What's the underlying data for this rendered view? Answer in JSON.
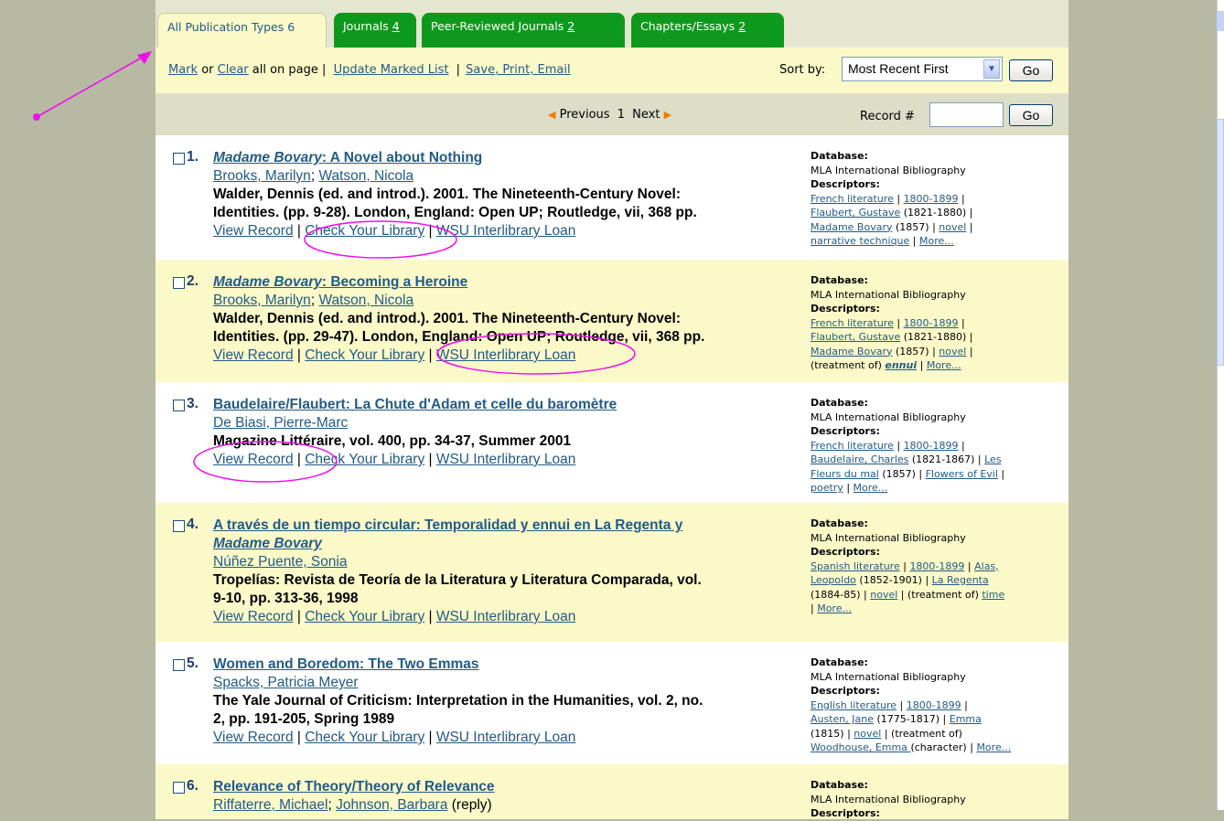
{
  "tabs": [
    {
      "label": "All Publication Types",
      "count": "6"
    },
    {
      "label": "Journals",
      "count": "4"
    },
    {
      "label": "Peer-Reviewed Journals",
      "count": "2"
    },
    {
      "label": "Chapters/Essays",
      "count": "2"
    }
  ],
  "toolbar": {
    "mark": "Mark",
    "or": " or ",
    "clear": "Clear",
    "all_on_page": " all on page ",
    "sep": "|",
    "update": "Update Marked List",
    "save": "Save, Print, Email",
    "sort_label": "Sort by:",
    "sort_value": "Most Recent First",
    "go": "Go"
  },
  "pager": {
    "previous": "Previous",
    "page": "1",
    "next": "Next",
    "record_label": "Record #",
    "go": "Go"
  },
  "colors": {
    "tab_green": "#0d9a1c",
    "link": "#225b87",
    "highlight_bg": "#fbf9c8",
    "annotation": "#ee11ee"
  },
  "results": [
    {
      "num": "1.",
      "title_italic": "Madame Bovary",
      "title_rest": ": A Novel about Nothing",
      "authors": [
        "Brooks, Marilyn",
        "Watson, Nicola"
      ],
      "source_lines": [
        "Walder, Dennis (ed. and introd.). 2001. The Nineteenth-Century Novel:",
        "Identities. (pp. 9-28). London, England: Open UP; Routledge, vii, 368 pp."
      ],
      "links": [
        "View Record",
        "Check Your Library",
        "WSU Interlibrary Loan"
      ],
      "database": "MLA International Bibliography",
      "descriptor_lines": [
        [
          {
            "t": "French literature",
            "l": true
          },
          {
            "t": " | ",
            "l": false
          },
          {
            "t": "1800-1899",
            "l": true
          },
          {
            "t": " |",
            "l": false
          }
        ],
        [
          {
            "t": "Flaubert, Gustave",
            "l": true
          },
          {
            "t": " (1821-1880) |",
            "l": false
          }
        ],
        [
          {
            "t": "Madame Bovary",
            "l": true
          },
          {
            "t": " (1857) | ",
            "l": false
          },
          {
            "t": "novel",
            "l": true
          },
          {
            "t": " |",
            "l": false
          }
        ],
        [
          {
            "t": "narrative technique",
            "l": true
          },
          {
            "t": " | ",
            "l": false
          },
          {
            "t": "More...",
            "l": true
          }
        ]
      ]
    },
    {
      "num": "2.",
      "title_italic": "Madame Bovary",
      "title_rest": ": Becoming a Heroine",
      "authors": [
        "Brooks, Marilyn",
        "Watson, Nicola"
      ],
      "source_lines": [
        "Walder, Dennis (ed. and introd.). 2001. The Nineteenth-Century Novel:",
        "Identities. (pp. 29-47). London, England: Open UP; Routledge, vii, 368 pp."
      ],
      "links": [
        "View Record",
        "Check Your Library",
        "WSU Interlibrary Loan"
      ],
      "database": "MLA International Bibliography",
      "descriptor_lines": [
        [
          {
            "t": "French literature",
            "l": true
          },
          {
            "t": " | ",
            "l": false
          },
          {
            "t": "1800-1899",
            "l": true
          },
          {
            "t": " |",
            "l": false
          }
        ],
        [
          {
            "t": "Flaubert, Gustave",
            "l": true
          },
          {
            "t": " (1821-1880) |",
            "l": false
          }
        ],
        [
          {
            "t": "Madame Bovary",
            "l": true
          },
          {
            "t": " (1857) | ",
            "l": false
          },
          {
            "t": "novel",
            "l": true
          },
          {
            "t": " |",
            "l": false
          }
        ],
        [
          {
            "t": "(treatment of) ",
            "l": false
          },
          {
            "t": "ennui",
            "l": true,
            "bi": true
          },
          {
            "t": " | ",
            "l": false
          },
          {
            "t": "More...",
            "l": true
          }
        ]
      ]
    },
    {
      "num": "3.",
      "title_italic": "",
      "title_rest": "Baudelaire/Flaubert: La Chute d'Adam et celle du baromètre",
      "authors": [
        "De Biasi, Pierre-Marc"
      ],
      "source_lines": [
        "Magazine Littéraire, vol. 400, pp. 34-37, Summer 2001"
      ],
      "links": [
        "View Record",
        "Check Your Library",
        "WSU Interlibrary Loan"
      ],
      "database": "MLA International Bibliography",
      "descriptor_lines": [
        [
          {
            "t": "French literature",
            "l": true
          },
          {
            "t": " | ",
            "l": false
          },
          {
            "t": "1800-1899",
            "l": true
          },
          {
            "t": " |",
            "l": false
          }
        ],
        [
          {
            "t": "Baudelaire, Charles",
            "l": true
          },
          {
            "t": " (1821-1867) | ",
            "l": false
          },
          {
            "t": "Les",
            "l": true
          }
        ],
        [
          {
            "t": "Fleurs du mal",
            "l": true
          },
          {
            "t": " (1857) | ",
            "l": false
          },
          {
            "t": "Flowers of Evil",
            "l": true
          },
          {
            "t": " |",
            "l": false
          }
        ],
        [
          {
            "t": "poetry",
            "l": true
          },
          {
            "t": " | ",
            "l": false
          },
          {
            "t": "More...",
            "l": true
          }
        ]
      ]
    },
    {
      "num": "4.",
      "title_italic": "",
      "title_rest": "A través de un tiempo circular: Temporalidad y ennui en La Regenta y",
      "title_line2_italic": "Madame Bovary",
      "authors": [
        "Núñez Puente, Sonia"
      ],
      "source_lines": [
        "Tropelías: Revista de Teoría de la Literatura y Literatura Comparada, vol.",
        "9-10, pp. 313-36, 1998"
      ],
      "links": [
        "View Record",
        "Check Your Library",
        "WSU Interlibrary Loan"
      ],
      "database": "MLA International Bibliography",
      "descriptor_lines": [
        [
          {
            "t": "Spanish literature",
            "l": true
          },
          {
            "t": " | ",
            "l": false
          },
          {
            "t": "1800-1899",
            "l": true
          },
          {
            "t": " | ",
            "l": false
          },
          {
            "t": "Alas,",
            "l": true
          }
        ],
        [
          {
            "t": "Leopoldo",
            "l": true
          },
          {
            "t": " (1852-1901) | ",
            "l": false
          },
          {
            "t": "La Regenta",
            "l": true
          }
        ],
        [
          {
            "t": "(1884-85) | ",
            "l": false
          },
          {
            "t": "novel",
            "l": true
          },
          {
            "t": " | (treatment of) ",
            "l": false
          },
          {
            "t": "time",
            "l": true
          }
        ],
        [
          {
            "t": "| ",
            "l": false
          },
          {
            "t": "More...",
            "l": true
          }
        ]
      ]
    },
    {
      "num": "5.",
      "title_italic": "",
      "title_rest": "Women and Boredom: The Two Emmas",
      "authors": [
        "Spacks, Patricia Meyer"
      ],
      "source_lines": [
        "The Yale Journal of Criticism: Interpretation in the Humanities, vol. 2, no.",
        "2, pp. 191-205, Spring 1989"
      ],
      "links": [
        "View Record",
        "Check Your Library",
        "WSU Interlibrary Loan"
      ],
      "database": "MLA International Bibliography",
      "descriptor_lines": [
        [
          {
            "t": "English literature",
            "l": true
          },
          {
            "t": " | ",
            "l": false
          },
          {
            "t": "1800-1899",
            "l": true
          },
          {
            "t": " |",
            "l": false
          }
        ],
        [
          {
            "t": "Austen, Jane",
            "l": true
          },
          {
            "t": " (1775-1817) | ",
            "l": false
          },
          {
            "t": "Emma",
            "l": true
          }
        ],
        [
          {
            "t": "(1815) | ",
            "l": false
          },
          {
            "t": "novel",
            "l": true
          },
          {
            "t": " | (treatment of)",
            "l": false
          }
        ],
        [
          {
            "t": "Woodhouse, Emma ",
            "l": true
          },
          {
            "t": "(character) | ",
            "l": false
          },
          {
            "t": "More...",
            "l": true
          }
        ]
      ]
    },
    {
      "num": "6.",
      "title_italic": "",
      "title_rest": "Relevance of Theory/Theory of Relevance",
      "authors": [
        "Riffaterre, Michael",
        "Johnson, Barbara"
      ],
      "authors_suffix": " (reply)",
      "source_lines": [],
      "links": [],
      "database": "MLA International Bibliography",
      "descriptor_lines": []
    }
  ],
  "labels": {
    "database": "Database:",
    "descriptors": "Descriptors:"
  }
}
